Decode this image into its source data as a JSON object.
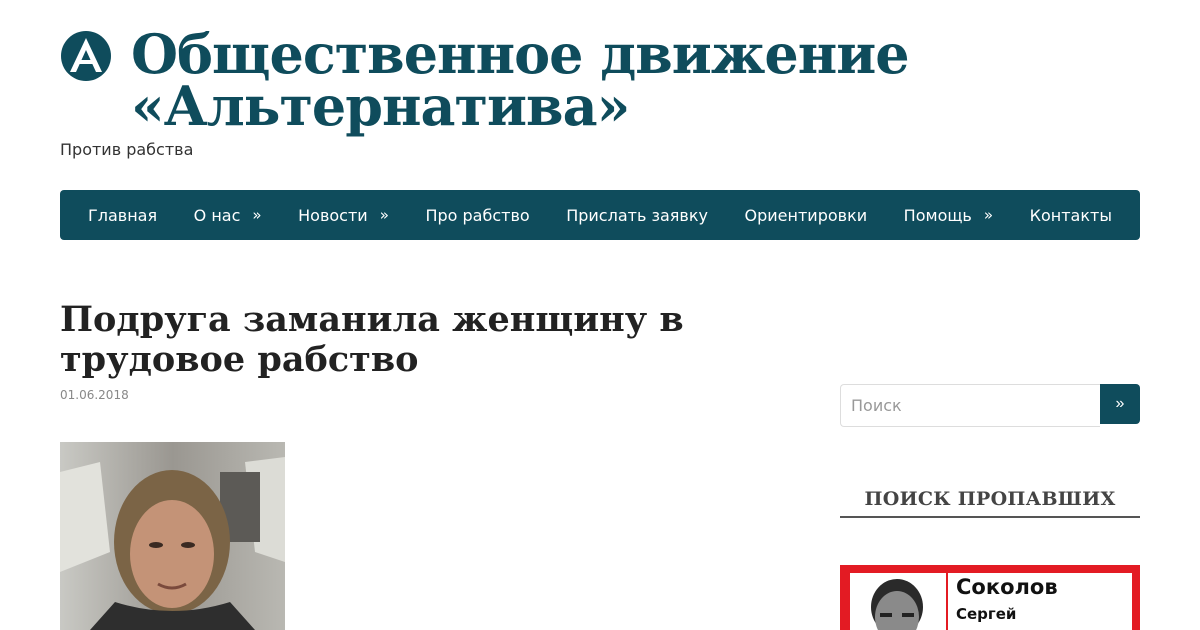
{
  "site": {
    "title_line1": "Общественное движение",
    "title_line2": "«Альтернатива»",
    "tagline": "Против рабства",
    "brand_color": "#0f4c5c"
  },
  "nav": {
    "items": [
      {
        "label": "Главная",
        "has_submenu": false
      },
      {
        "label": "О нас",
        "has_submenu": true
      },
      {
        "label": "Новости",
        "has_submenu": true
      },
      {
        "label": "Про рабство",
        "has_submenu": false
      },
      {
        "label": "Прислать заявку",
        "has_submenu": false
      },
      {
        "label": "Ориентировки",
        "has_submenu": false
      },
      {
        "label": "Помощь",
        "has_submenu": true
      },
      {
        "label": "Контакты",
        "has_submenu": false
      }
    ],
    "submenu_glyph": "»"
  },
  "post": {
    "title": "Подруга заманила женщину в трудовое рабство",
    "date": "01.06.2018"
  },
  "sidebar": {
    "search": {
      "placeholder": "Поиск",
      "button_label": "»"
    },
    "missing_widget": {
      "title": "ПОИСК ПРОПАВШИХ",
      "card": {
        "surname": "Соколов",
        "name": "Сергей",
        "accent_color": "#e31b23"
      }
    }
  }
}
